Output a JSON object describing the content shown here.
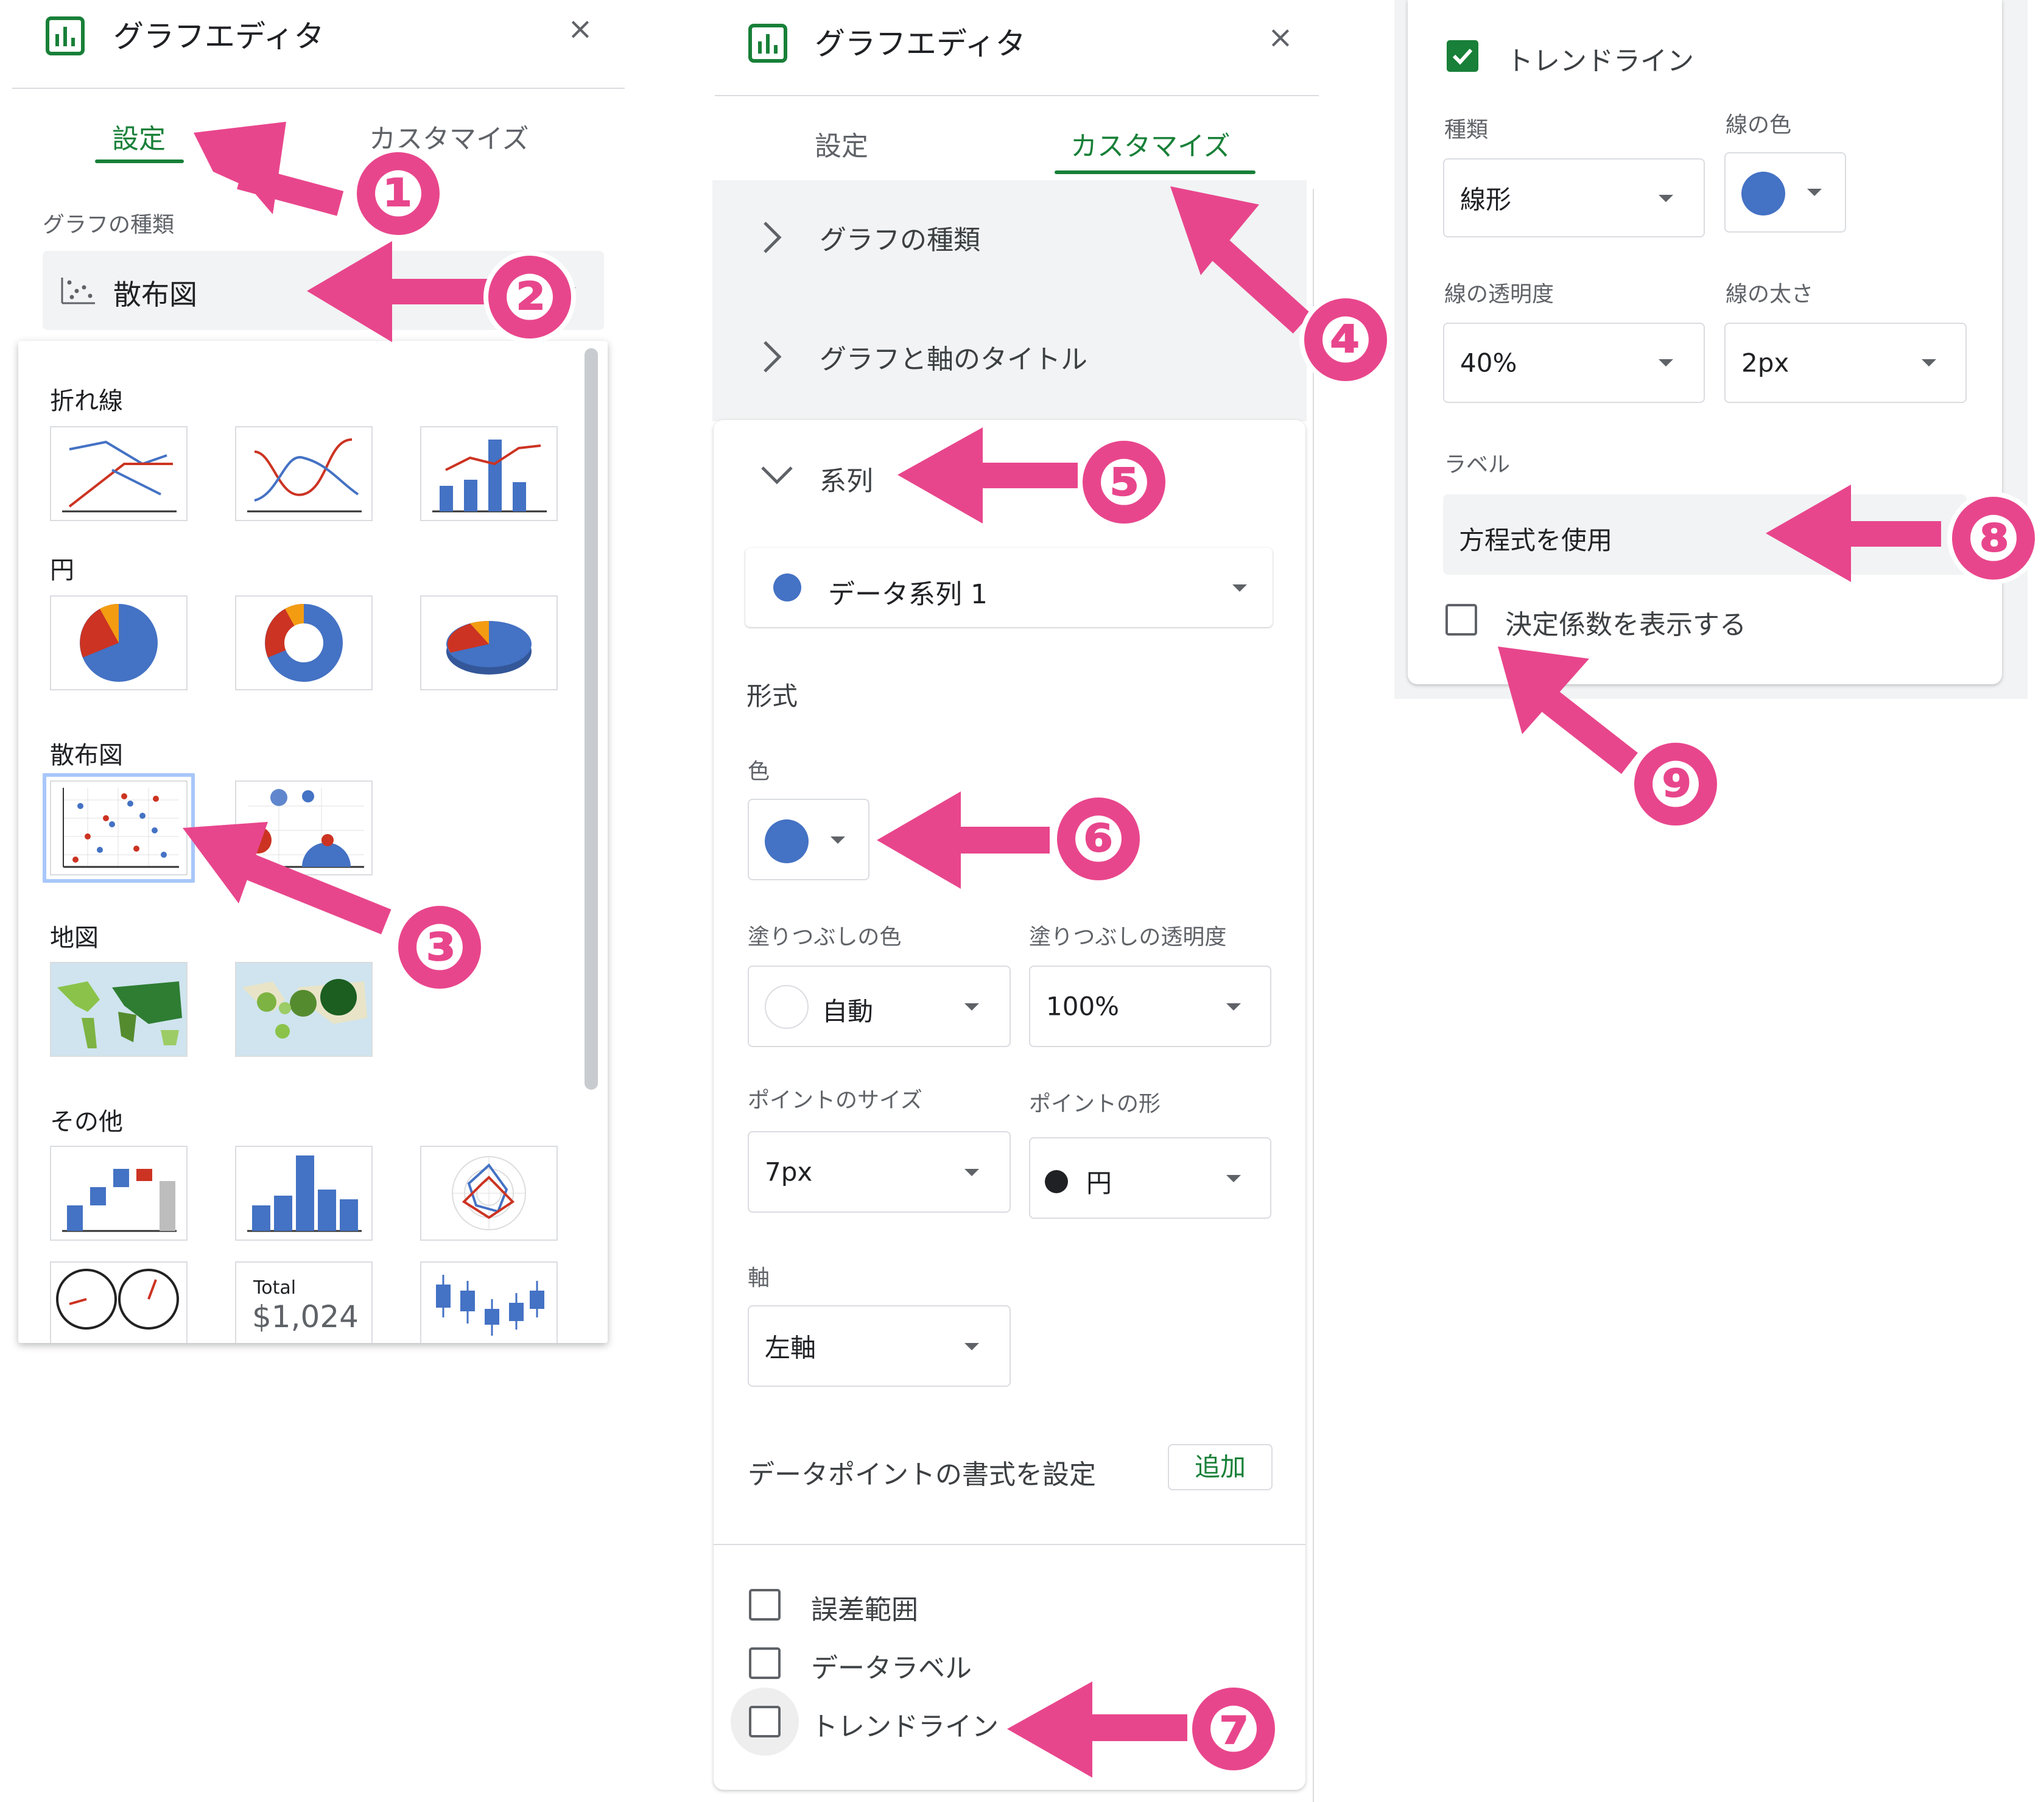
{
  "panel1": {
    "title": "グラフエディタ",
    "close": "×",
    "tab_setup": "設定",
    "tab_customize": "カスタマイズ",
    "chart_type_label": "グラフの種類",
    "chart_type_value": "散布図",
    "categories": {
      "line": "折れ線",
      "pie": "円",
      "scatter": "散布図",
      "map": "地図",
      "other": "その他"
    },
    "scorecard_title": "Total",
    "scorecard_value": "$1,024"
  },
  "panel2": {
    "title": "グラフエディタ",
    "close": "×",
    "tab_setup": "設定",
    "tab_customize": "カスタマイズ",
    "section_chart_type": "グラフの種類",
    "section_titles": "グラフと軸のタイトル",
    "section_series": "系列",
    "series_select": "データ系列 1",
    "format_heading": "形式",
    "color_label": "色",
    "fill_color_label": "塗りつぶしの色",
    "fill_color_value": "自動",
    "fill_opacity_label": "塗りつぶしの透明度",
    "fill_opacity_value": "100%",
    "point_size_label": "ポイントのサイズ",
    "point_size_value": "7px",
    "point_shape_label": "ポイントの形",
    "point_shape_value": "円",
    "axis_label": "軸",
    "axis_value": "左軸",
    "datapoint_format_label": "データポイントの書式を設定",
    "add_button": "追加",
    "error_bars": "誤差範囲",
    "data_labels": "データラベル",
    "trendline": "トレンドライン"
  },
  "panel3": {
    "trendline": "トレンドライン",
    "type_label": "種類",
    "type_value": "線形",
    "line_color_label": "線の色",
    "line_opacity_label": "線の透明度",
    "line_opacity_value": "40%",
    "line_width_label": "線の太さ",
    "line_width_value": "2px",
    "label_label": "ラベル",
    "label_value": "方程式を使用",
    "show_r2": "決定係数を表示する"
  },
  "badges": [
    "❶",
    "❷",
    "❸",
    "❹",
    "❺",
    "❻",
    "❼",
    "❽",
    "❾"
  ],
  "colors": {
    "accent_green": "#188038",
    "series_blue": "#4472c4",
    "arrow_pink": "#e8468c",
    "series_red": "#cc3322"
  }
}
